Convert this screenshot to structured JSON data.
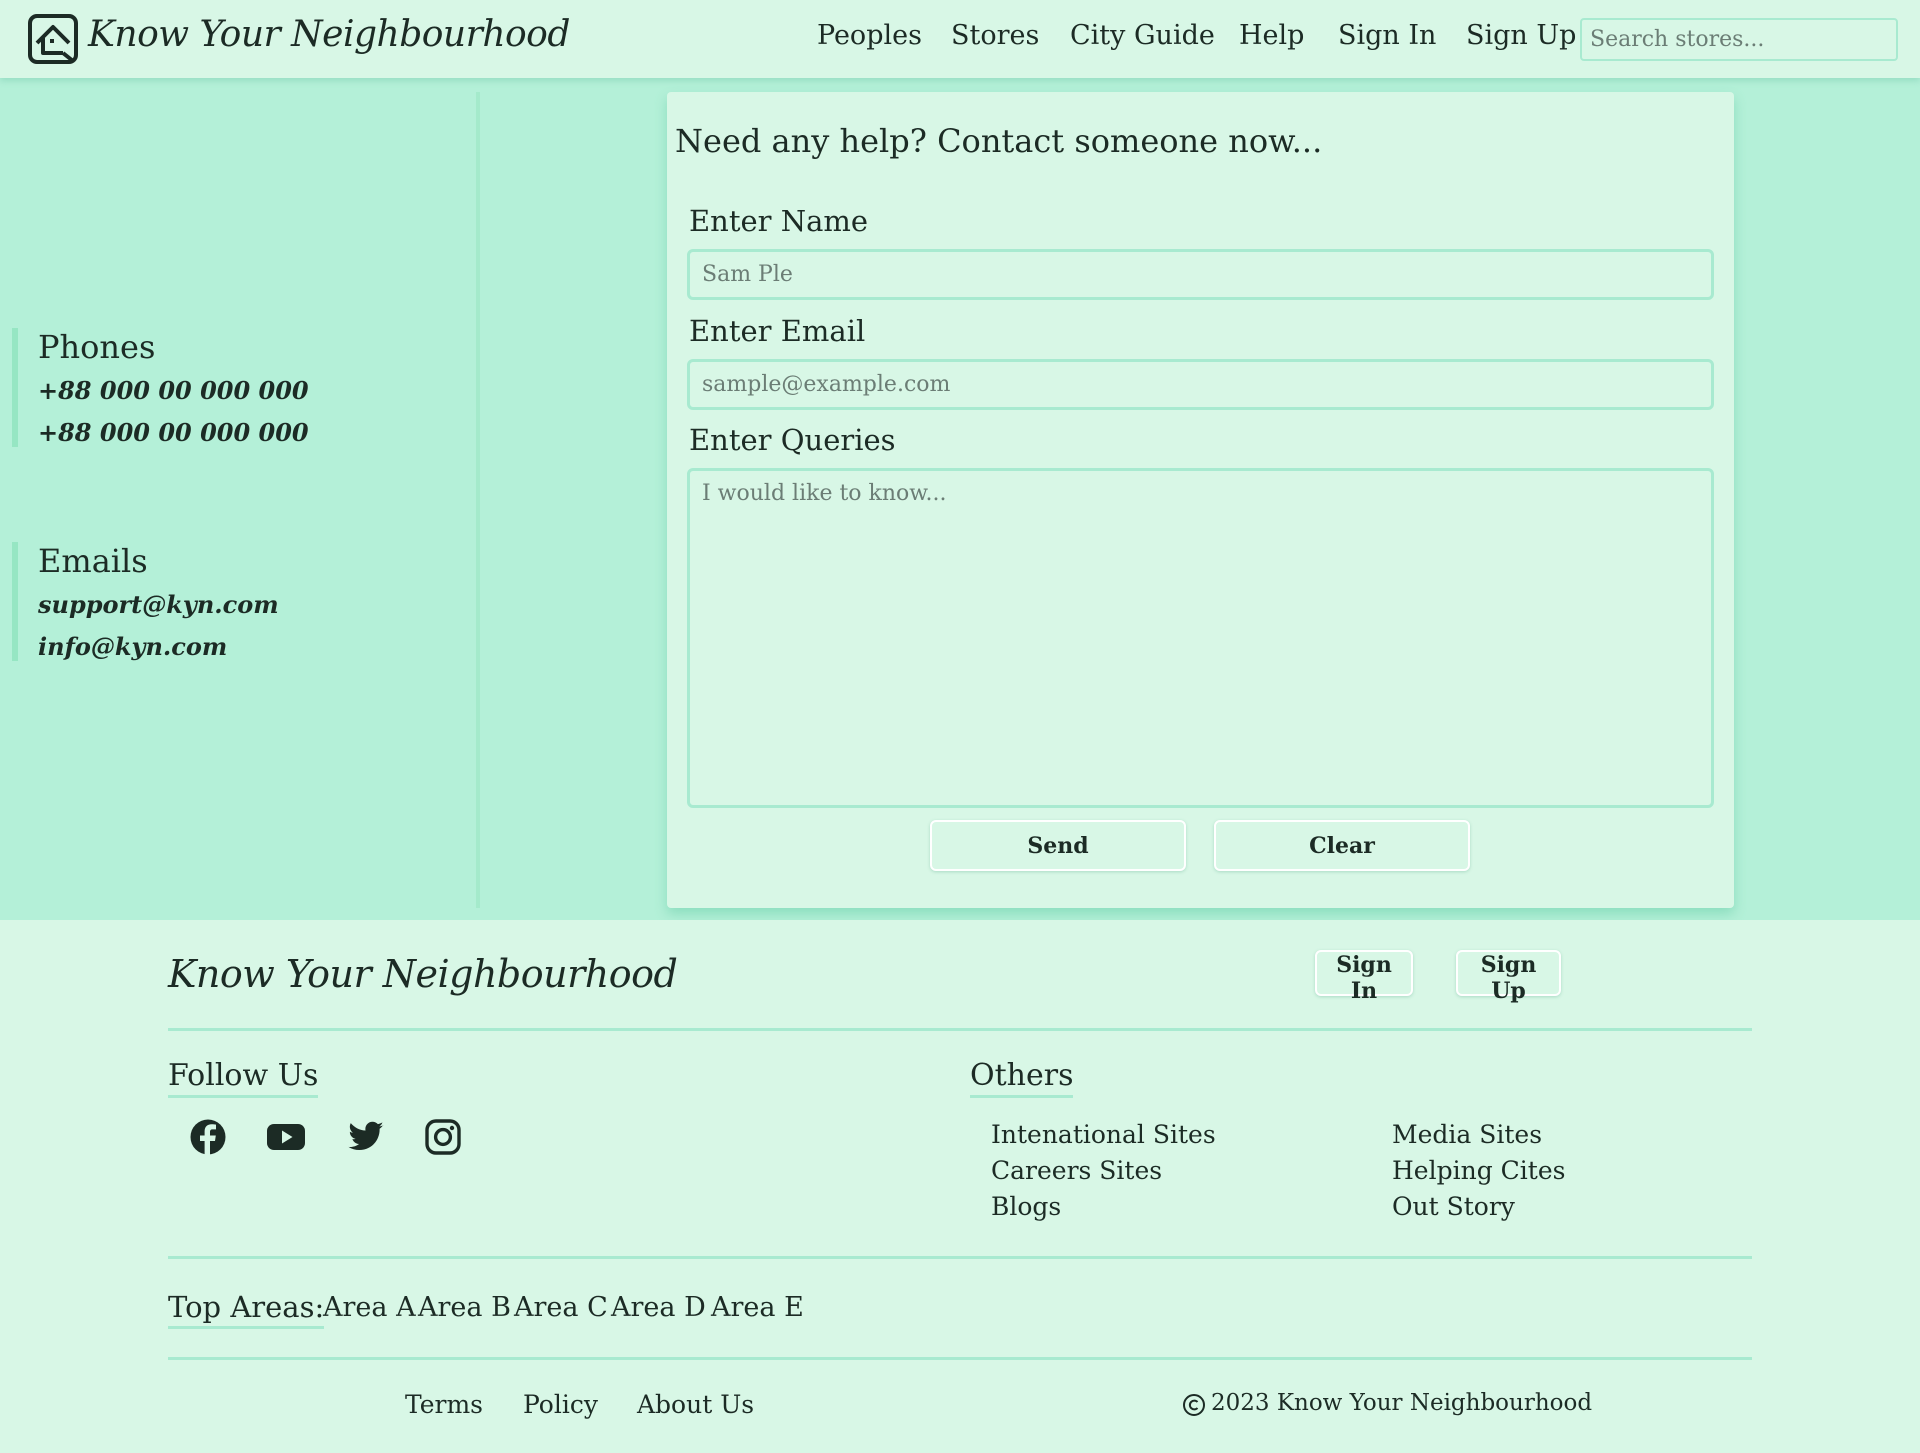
{
  "brand": {
    "name": "Know Your Neighbourhood",
    "logo_icon": "house-in-frame-icon"
  },
  "nav": {
    "links": [
      "Peoples",
      "Stores",
      "City Guide",
      "Help",
      "Sign In",
      "Sign Up"
    ],
    "search_placeholder": "Search stores..."
  },
  "contact": {
    "phones_title": "Phones",
    "phones": [
      "+88 000 00 000 000",
      "+88 000 00 000 000"
    ],
    "emails_title": "Emails",
    "emails": [
      "support@kyn.com",
      "info@kyn.com"
    ]
  },
  "form": {
    "title": "Need any help? Contact someone now...",
    "name_label": "Enter Name",
    "name_placeholder": "Sam Ple",
    "email_label": "Enter Email",
    "email_placeholder": "sample@example.com",
    "queries_label": "Enter Queries",
    "queries_placeholder": "I would like to know...",
    "send_label": "Send",
    "clear_label": "Clear"
  },
  "footer": {
    "brand": "Know Your Neighbourhood",
    "sign_in": "Sign In",
    "sign_up": "Sign Up",
    "follow_title": "Follow Us",
    "social_icons": [
      "facebook-icon",
      "youtube-icon",
      "twitter-icon",
      "instagram-icon"
    ],
    "others_title": "Others",
    "others_col1": [
      "Intenational Sites",
      "Careers Sites",
      "Blogs"
    ],
    "others_col2": [
      "Media Sites",
      "Helping Cites",
      "Out Story"
    ],
    "top_areas_label": "Top Areas:",
    "areas": [
      "Area A",
      "Area B",
      "Area C",
      "Area D",
      "Area E"
    ],
    "bottom_links": [
      "Terms",
      "Policy",
      "About Us"
    ],
    "copyright": "2023 Know Your Neighbourhood"
  },
  "colors": {
    "page_bg": "#d8f7e6",
    "main_bg": "#b4f0d8",
    "accent_border": "#a8ead0",
    "text": "#1c2b25"
  }
}
